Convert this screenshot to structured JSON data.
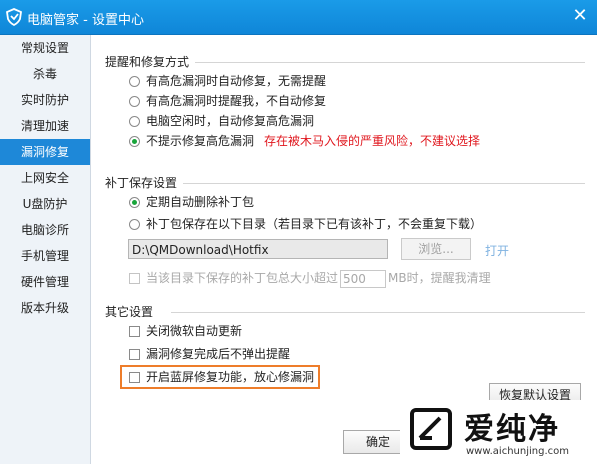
{
  "window": {
    "title": "电脑管家 - 设置中心",
    "close_glyph": "✕"
  },
  "sidebar": {
    "items": [
      {
        "label": "常规设置"
      },
      {
        "label": "杀毒"
      },
      {
        "label": "实时防护"
      },
      {
        "label": "清理加速"
      },
      {
        "label": "漏洞修复",
        "active": true
      },
      {
        "label": "上网安全"
      },
      {
        "label": "U盘防护"
      },
      {
        "label": "电脑诊所"
      },
      {
        "label": "手机管理"
      },
      {
        "label": "硬件管理"
      },
      {
        "label": "版本升级"
      }
    ]
  },
  "repair_mode": {
    "title": "提醒和修复方式",
    "options": [
      {
        "label": "有高危漏洞时自动修复，无需提醒",
        "checked": false
      },
      {
        "label": "有高危漏洞时提醒我，不自动修复",
        "checked": false
      },
      {
        "label": "电脑空闲时，自动修复高危漏洞",
        "checked": false
      },
      {
        "label": "不提示修复高危漏洞",
        "checked": true
      }
    ],
    "warning": "存在被木马入侵的严重风险，不建议选择"
  },
  "patch_save": {
    "title": "补丁保存设置",
    "options": [
      {
        "label": "定期自动删除补丁包",
        "checked": true
      },
      {
        "label": "补丁包保存在以下目录（若目录下已有该补丁，不会重复下载）",
        "checked": false
      }
    ],
    "path_value": "D:\\QMDownload\\Hotfix",
    "browse_label": "浏览...",
    "open_label": "打开",
    "size_check_prefix": "当该目录下保存的补丁包总大小超过",
    "size_value": "500",
    "size_check_suffix": "MB时，提醒我清理"
  },
  "other": {
    "title": "其它设置",
    "options": [
      {
        "label": "关闭微软自动更新",
        "checked": false
      },
      {
        "label": "漏洞修复完成后不弹出提醒",
        "checked": false
      },
      {
        "label": "开启蓝屏修复功能，放心修漏洞",
        "checked": false
      }
    ]
  },
  "buttons": {
    "restore": "恢复默认设置",
    "confirm": "确定"
  },
  "watermark": {
    "name": "爱纯净",
    "url": "www.aichunjing.com"
  },
  "colors": {
    "accent": "#1e88d8",
    "warning": "#e0171e",
    "highlight": "#ee7d2a",
    "radio_checked": "#19a53b"
  }
}
